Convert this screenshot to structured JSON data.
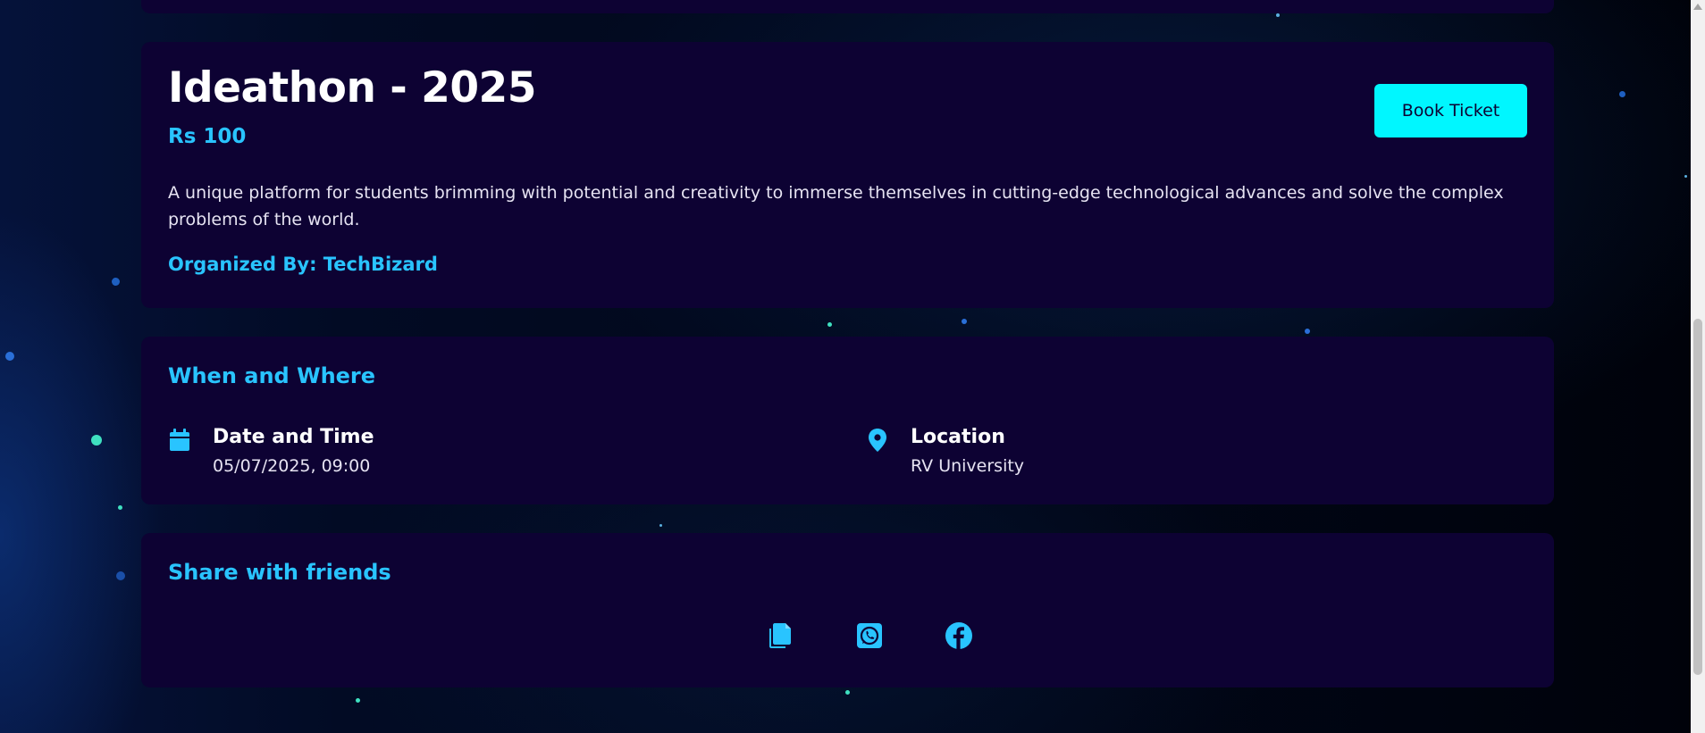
{
  "event": {
    "title": "Ideathon - 2025",
    "price": "Rs 100",
    "book_label": "Book Ticket",
    "description": "A unique platform for students brimming with potential and creativity to immerse themselves in cutting-edge technological advances and solve the complex problems of the world.",
    "organizer": "Organized By: TechBizard"
  },
  "when_where": {
    "title": "When and Where",
    "date_label": "Date and Time",
    "date_value": "05/07/2025, 09:00",
    "location_label": "Location",
    "location_value": "RV University",
    "date_icon": "calendar-icon",
    "location_icon": "map-pin-icon"
  },
  "share": {
    "title": "Share with friends",
    "icons": [
      "copy-icon",
      "whatsapp-icon",
      "facebook-icon"
    ]
  },
  "colors": {
    "card_bg": "#0d0233",
    "accent_cyan": "#29c4ff",
    "button_bg": "#00f7ff",
    "page_bg": "#010514"
  }
}
